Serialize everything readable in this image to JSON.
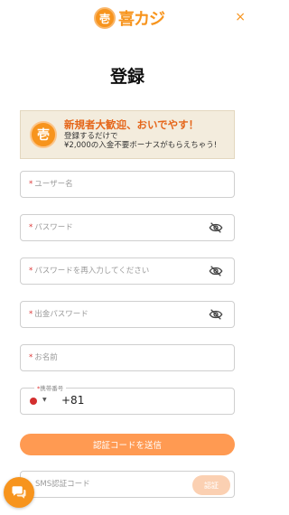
{
  "header": {
    "logo_mark": "壱",
    "logo_text": "喜カジ",
    "close_glyph": "×"
  },
  "page_title": "登録",
  "banner": {
    "seal": "壱",
    "headline": "新規者大歓迎、おいでやす！",
    "line1": "登録するだけで",
    "line2": "¥2,000の入金不要ボーナスがもらえちゃう!"
  },
  "form": {
    "required_mark": "*",
    "username_placeholder": "ユーザー名",
    "password_placeholder": "パスワード",
    "password_confirm_placeholder": "パスワードを再入力してください",
    "withdraw_password_placeholder": "出金パスワード",
    "name_placeholder": "お名前",
    "phone_label": "携帯番号",
    "phone_dial_code": "+81",
    "send_code_label": "認証コードを送信",
    "sms_code_placeholder": "SMS認証コード",
    "verify_label": "認証"
  },
  "colors": {
    "accent": "#f7941d",
    "button": "#ff9a52",
    "button_disabled": "#fbd0b2",
    "flag": "#d32f2f"
  },
  "icons": {
    "eye": "eye-off-icon",
    "chat": "chat-icon",
    "caret": "caret-down-icon"
  }
}
